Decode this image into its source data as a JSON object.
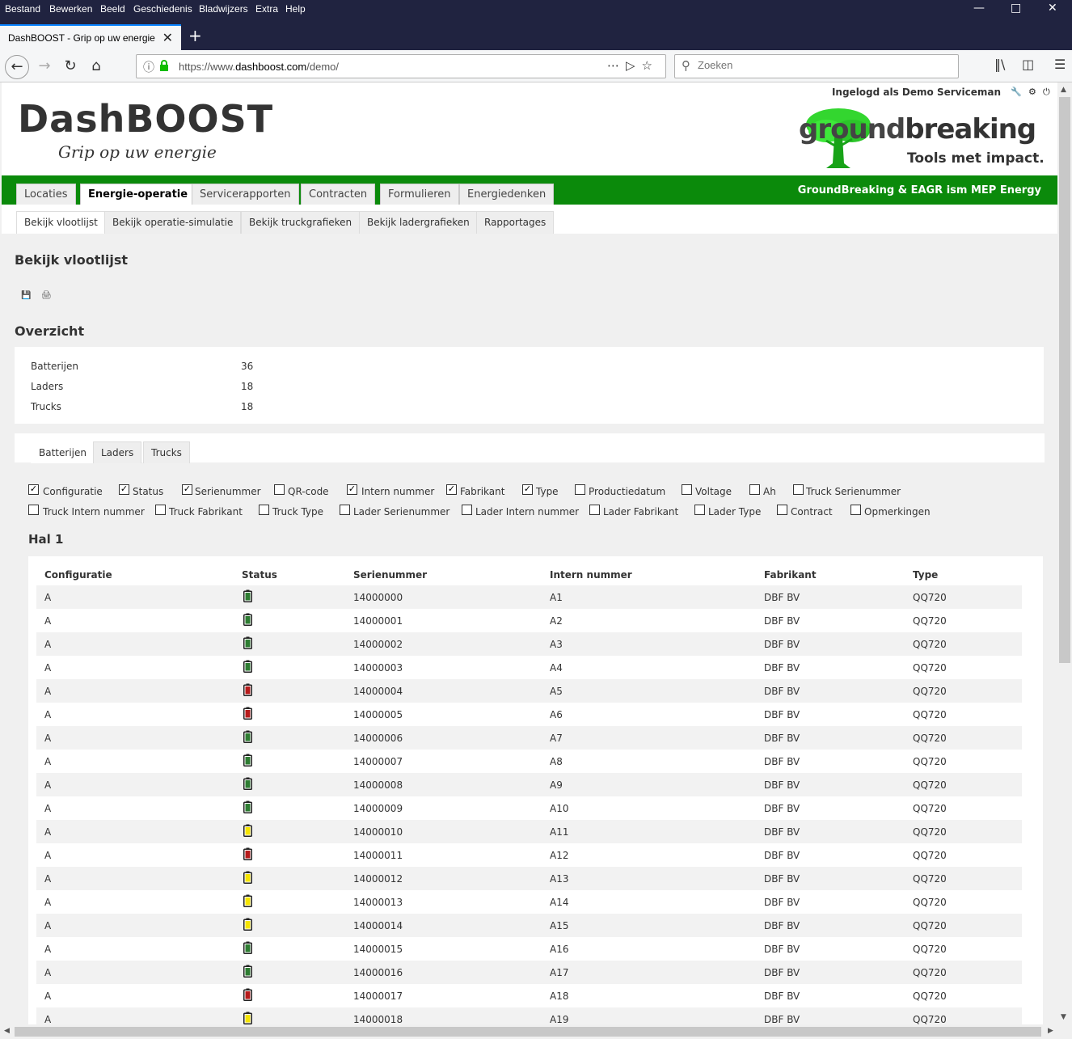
{
  "browser": {
    "menu": [
      "Bestand",
      "Bewerken",
      "Beeld",
      "Geschiedenis",
      "Bladwijzers",
      "Extra",
      "Help"
    ],
    "tab_title": "DashBOOST - Grip op uw energie",
    "url_prefix": "https://www.",
    "url_domain": "dashboost.com",
    "url_path": "/demo/",
    "search_placeholder": "Zoeken"
  },
  "header": {
    "logo_title": "DashBOOST",
    "logo_sub": "Grip op uw energie",
    "login_text": "Ingelogd als Demo Serviceman",
    "partner_name_light": "ground",
    "partner_name_dark": "breaking",
    "partner_tagline": "Tools met impact."
  },
  "main_nav": {
    "tabs": [
      "Locaties",
      "Energie-operatie",
      "Servicerapporten",
      "Contracten",
      "Formulieren",
      "Energiedenken"
    ],
    "active": "Energie-operatie",
    "right_text": "GroundBreaking & EAGR ism MEP Energy"
  },
  "sub_nav": {
    "tabs": [
      "Bekijk vlootlijst",
      "Bekijk operatie-simulatie",
      "Bekijk truckgrafieken",
      "Bekijk ladergrafieken",
      "Rapportages"
    ],
    "active": "Bekijk vlootlijst"
  },
  "page_title": "Bekijk vlootlijst",
  "overview": {
    "title": "Overzicht",
    "rows": [
      {
        "label": "Batterijen",
        "value": "36"
      },
      {
        "label": "Laders",
        "value": "18"
      },
      {
        "label": "Trucks",
        "value": "18"
      }
    ]
  },
  "data_tabs": [
    "Batterijen",
    "Laders",
    "Trucks"
  ],
  "columns": [
    {
      "label": "Configuratie",
      "checked": true
    },
    {
      "label": "Status",
      "checked": true
    },
    {
      "label": "Serienummer",
      "checked": true
    },
    {
      "label": "QR-code",
      "checked": false
    },
    {
      "label": "Intern nummer",
      "checked": true
    },
    {
      "label": "Fabrikant",
      "checked": true
    },
    {
      "label": "Type",
      "checked": true
    },
    {
      "label": "Productiedatum",
      "checked": false
    },
    {
      "label": "Voltage",
      "checked": false
    },
    {
      "label": "Ah",
      "checked": false
    },
    {
      "label": "Truck Serienummer",
      "checked": false
    },
    {
      "label": "Truck Intern nummer",
      "checked": false
    },
    {
      "label": "Truck Fabrikant",
      "checked": false
    },
    {
      "label": "Truck Type",
      "checked": false
    },
    {
      "label": "Lader Serienummer",
      "checked": false
    },
    {
      "label": "Lader Intern nummer",
      "checked": false
    },
    {
      "label": "Lader Fabrikant",
      "checked": false
    },
    {
      "label": "Lader Type",
      "checked": false
    },
    {
      "label": "Contract",
      "checked": false
    },
    {
      "label": "Opmerkingen",
      "checked": false
    }
  ],
  "hall_title": "Hal 1",
  "table": {
    "headers": [
      "Configuratie",
      "Status",
      "Serienummer",
      "Intern nummer",
      "Fabrikant",
      "Type"
    ],
    "rows": [
      [
        "A",
        "green",
        "14000000",
        "A1",
        "DBF BV",
        "QQ720"
      ],
      [
        "A",
        "green",
        "14000001",
        "A2",
        "DBF BV",
        "QQ720"
      ],
      [
        "A",
        "green",
        "14000002",
        "A3",
        "DBF BV",
        "QQ720"
      ],
      [
        "A",
        "green",
        "14000003",
        "A4",
        "DBF BV",
        "QQ720"
      ],
      [
        "A",
        "red",
        "14000004",
        "A5",
        "DBF BV",
        "QQ720"
      ],
      [
        "A",
        "red",
        "14000005",
        "A6",
        "DBF BV",
        "QQ720"
      ],
      [
        "A",
        "green",
        "14000006",
        "A7",
        "DBF BV",
        "QQ720"
      ],
      [
        "A",
        "green",
        "14000007",
        "A8",
        "DBF BV",
        "QQ720"
      ],
      [
        "A",
        "green",
        "14000008",
        "A9",
        "DBF BV",
        "QQ720"
      ],
      [
        "A",
        "green",
        "14000009",
        "A10",
        "DBF BV",
        "QQ720"
      ],
      [
        "A",
        "yellow",
        "14000010",
        "A11",
        "DBF BV",
        "QQ720"
      ],
      [
        "A",
        "red",
        "14000011",
        "A12",
        "DBF BV",
        "QQ720"
      ],
      [
        "A",
        "yellow",
        "14000012",
        "A13",
        "DBF BV",
        "QQ720"
      ],
      [
        "A",
        "yellow",
        "14000013",
        "A14",
        "DBF BV",
        "QQ720"
      ],
      [
        "A",
        "yellow",
        "14000014",
        "A15",
        "DBF BV",
        "QQ720"
      ],
      [
        "A",
        "green",
        "14000015",
        "A16",
        "DBF BV",
        "QQ720"
      ],
      [
        "A",
        "green",
        "14000016",
        "A17",
        "DBF BV",
        "QQ720"
      ],
      [
        "A",
        "red",
        "14000017",
        "A18",
        "DBF BV",
        "QQ720"
      ],
      [
        "A",
        "yellow",
        "14000018",
        "A19",
        "DBF BV",
        "QQ720"
      ]
    ]
  },
  "status_colors": {
    "green": "#2e7d32",
    "red": "#b71c1c",
    "yellow": "#f5e400"
  },
  "colors": {
    "brand_green": "#0b8a0b",
    "chrome_dark": "#202340"
  }
}
